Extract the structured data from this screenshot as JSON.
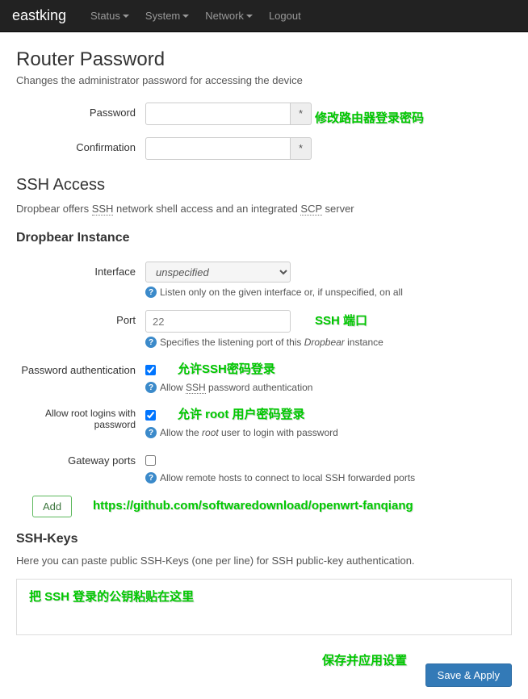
{
  "navbar": {
    "brand": "eastking",
    "items": [
      "Status",
      "System",
      "Network",
      "Logout"
    ]
  },
  "router_password": {
    "title": "Router Password",
    "desc": "Changes the administrator password for accessing the device",
    "password_label": "Password",
    "confirmation_label": "Confirmation",
    "addon": "*"
  },
  "ssh_access": {
    "title": "SSH Access",
    "desc_pre": "Dropbear offers ",
    "desc_mid": " network shell access and an integrated ",
    "desc_post": " server",
    "ssh_abbr": "SSH",
    "scp_abbr": "SCP"
  },
  "dropbear": {
    "title": "Dropbear Instance",
    "interface_label": "Interface",
    "interface_value": "unspecified",
    "interface_help": "Listen only on the given interface or, if unspecified, on all",
    "port_label": "Port",
    "port_placeholder": "22",
    "port_help_pre": "Specifies the listening port of this ",
    "port_help_em": "Dropbear",
    "port_help_post": " instance",
    "pwauth_label": "Password authentication",
    "pwauth_help_pre": "Allow ",
    "pwauth_help_abbr": "SSH",
    "pwauth_help_post": " password authentication",
    "rootlogin_label": "Allow root logins with password",
    "rootlogin_help_pre": "Allow the ",
    "rootlogin_help_em": "root",
    "rootlogin_help_post": " user to login with password",
    "gateway_label": "Gateway ports",
    "gateway_help": "Allow remote hosts to connect to local SSH forwarded ports",
    "add_btn": "Add"
  },
  "sshkeys": {
    "title": "SSH-Keys",
    "desc": "Here you can paste public SSH-Keys (one per line) for SSH public-key authentication."
  },
  "footer": {
    "save_apply": "Save & Apply"
  },
  "annotations": {
    "a1": "修改路由器登录密码",
    "a2": "SSH 端口",
    "a3": "允许SSH密码登录",
    "a4": "允许 root 用户密码登录",
    "a5": "https://github.com/softwaredownload/openwrt-fanqiang",
    "a6": "把 SSH 登录的公钥粘贴在这里",
    "a7": "保存并应用设置"
  }
}
